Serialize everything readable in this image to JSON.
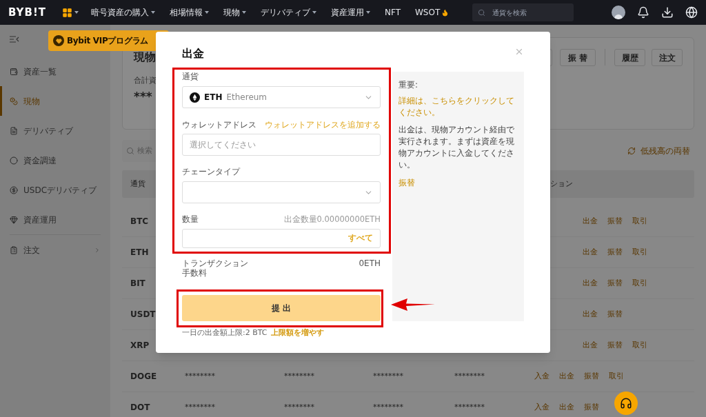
{
  "top_nav": {
    "logo": "BYB!T",
    "menu_items": [
      {
        "label": "暗号資産の購入",
        "kind": "dropdown"
      },
      {
        "label": "相場情報",
        "kind": "dropdown"
      },
      {
        "label": "現物",
        "kind": "dropdown"
      },
      {
        "label": "デリバティブ",
        "kind": "dropdown"
      },
      {
        "label": "資産運用",
        "kind": "dropdown"
      },
      {
        "label": "NFT",
        "kind": "plain"
      },
      {
        "label": "WSOT",
        "kind": "hot"
      }
    ],
    "search": {
      "placeholder": "通貨を検索"
    }
  },
  "vip_banner": {
    "text": "Bybit VIPプログラム"
  },
  "sidebar": {
    "items": [
      {
        "label": "資産一覧",
        "selected": false,
        "expandable": false
      },
      {
        "label": "現物",
        "selected": true,
        "expandable": false
      },
      {
        "label": "デリバティブ",
        "selected": false,
        "expandable": false
      },
      {
        "label": "資金調達",
        "selected": false,
        "expandable": false
      },
      {
        "label": "USDCデリバティブ",
        "selected": false,
        "expandable": false
      },
      {
        "label": "資産運用",
        "selected": false,
        "expandable": false
      },
      {
        "label": "注文",
        "selected": false,
        "expandable": true
      }
    ]
  },
  "summary_card": {
    "title": "現物",
    "total_label": "合計資",
    "total_value": "***",
    "buttons": [
      "振 替",
      "履歴",
      "注文"
    ]
  },
  "asset_search": {
    "placeholder": "検索"
  },
  "small_balance_link": "低残高の両替",
  "table": {
    "columns": [
      "通貨",
      "ション"
    ],
    "rows": [
      {
        "currency": "BTC",
        "actions": [
          "出金",
          "振替",
          "取引"
        ]
      },
      {
        "currency": "ETH",
        "actions": [
          "出金",
          "振替",
          "取引"
        ]
      },
      {
        "currency": "BIT",
        "actions": [
          "出金",
          "振替",
          "取引"
        ]
      },
      {
        "currency": "USDT",
        "actions": [
          "出金",
          "振替"
        ]
      },
      {
        "currency": "XRP",
        "actions": [
          "出金",
          "振替",
          "取引"
        ]
      },
      {
        "currency": "DOGE",
        "cells": [
          "********",
          "********",
          "********",
          "********"
        ],
        "actions": [
          "入金",
          "出金",
          "振替",
          "取引"
        ]
      },
      {
        "currency": "DOT",
        "cells": [
          "********",
          "********",
          "********",
          "********"
        ],
        "actions": [
          "入金",
          "出金",
          "振替"
        ]
      }
    ]
  },
  "withdraw_modal": {
    "title": "出金",
    "coin_label": "通貨",
    "coin": {
      "symbol": "ETH",
      "name": "Ethereum"
    },
    "address_label": "ウォレットアドレス",
    "add_address_link": "ウォレットアドレスを追加する",
    "address_placeholder": "選択してください",
    "chain_label": "チェーンタイプ",
    "amount_label": "数量",
    "amount_available": "出金数量0.00000000ETH",
    "all_button": "すべて",
    "fee_label": "トランザクション手数料",
    "fee_value": "0ETH",
    "submit": "提 出",
    "limit_text": "一日の出金額上限:2 BTC",
    "limit_link": "上限額を増やす",
    "info": {
      "heading": "重要:",
      "details_link": "詳細は、こちらをクリックしてください。",
      "note": "出金は、現物アカウント経由で実行されます。まずは資産を現物アカウントに入金してください。",
      "transfer_link": "振替"
    }
  }
}
